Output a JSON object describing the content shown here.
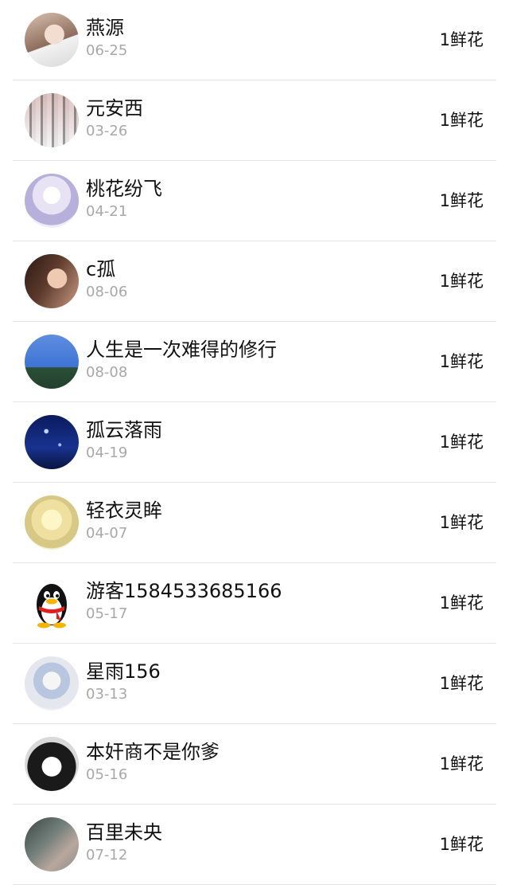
{
  "rows": [
    {
      "name": "燕源",
      "date": "06-25",
      "gift": "1鲜花",
      "avatar": "photo-avatar"
    },
    {
      "name": "元安西",
      "date": "03-26",
      "gift": "1鲜花",
      "avatar": "photo-avatar"
    },
    {
      "name": "桃花纷飞",
      "date": "04-21",
      "gift": "1鲜花",
      "avatar": "anime-avatar"
    },
    {
      "name": "c孤",
      "date": "08-06",
      "gift": "1鲜花",
      "avatar": "photo-avatar"
    },
    {
      "name": "人生是一次难得的修行",
      "date": "08-08",
      "gift": "1鲜花",
      "avatar": "landscape-avatar"
    },
    {
      "name": "孤云落雨",
      "date": "04-19",
      "gift": "1鲜花",
      "avatar": "night-sky-avatar"
    },
    {
      "name": "轻衣灵眸",
      "date": "04-07",
      "gift": "1鲜花",
      "avatar": "anime-avatar"
    },
    {
      "name": "游客1584533685166",
      "date": "05-17",
      "gift": "1鲜花",
      "avatar": "penguin-avatar"
    },
    {
      "name": "星雨156",
      "date": "03-13",
      "gift": "1鲜花",
      "avatar": "anime-avatar"
    },
    {
      "name": "本奸商不是你爹",
      "date": "05-16",
      "gift": "1鲜花",
      "avatar": "anime-avatar"
    },
    {
      "name": "百里未央",
      "date": "07-12",
      "gift": "1鲜花",
      "avatar": "photo-avatar"
    }
  ],
  "colors": {
    "text_primary": "#111111",
    "text_secondary": "#a8a8a8",
    "divider": "#e5e5e5",
    "background": "#ffffff"
  }
}
